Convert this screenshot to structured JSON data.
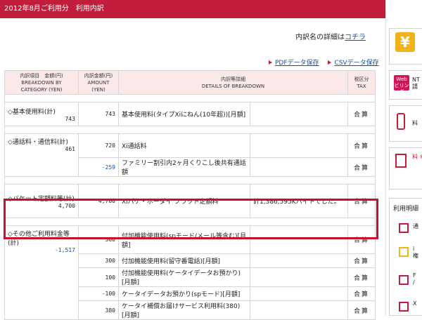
{
  "header": {
    "title": "2012年8月ご利用分　利用内訳"
  },
  "detail_note": {
    "text": "内訳名の詳細は",
    "link": "コチラ"
  },
  "downloads": {
    "pdf": "PDFデータ保存",
    "csv": "CSVデータ保存"
  },
  "table": {
    "headers": {
      "category": "内訳項目　金額(円)\nBREAKDOWN BY\nCATEGORY (YEN)",
      "amount": "内訳金額(円)\nAMOUNT\n(YEN)",
      "details": "内訳等詳細\nDETAILS OF BREAKDOWN",
      "tax": "税区分\nTAX"
    },
    "groups": [
      {
        "category": "◇基本使用料(計)",
        "total": "743",
        "rows": [
          {
            "amount": "743",
            "detail": "基本使用料(タイプXiにねん(10年超))[月額]",
            "note": "",
            "tax": "合算"
          }
        ]
      },
      {
        "category": "◇通話料・通信料(計)",
        "total": "461",
        "rows": [
          {
            "amount": "720",
            "detail": "Xi通話料",
            "note": "",
            "tax": "合算"
          },
          {
            "amount": "-259",
            "detail": "ファミリー割引内2ヶ月くりこし後共有通話額",
            "note": "",
            "tax": "合算"
          }
        ]
      },
      {
        "category": "◇パケット定額料等(計)",
        "total": "4,700",
        "rows": [
          {
            "amount": "4,700",
            "detail": "Xiパケ・ホーダイ フラット定額料",
            "note": "計1,386,595Kバイトでした。",
            "tax": "合算"
          }
        ]
      },
      {
        "category": "◇その他ご利用料金等(計)",
        "total": "-1,517",
        "rows": [
          {
            "amount": "300",
            "detail": "付加機能使用料(spモード/メール等含む)[月額]",
            "note": "",
            "tax": "合算"
          },
          {
            "amount": "300",
            "detail": "付加機能使用料(留守番電話)[月額]",
            "note": "",
            "tax": "合算"
          },
          {
            "amount": "100",
            "detail": "付加機能使用料(ケータイデータお預かり)[月額]",
            "note": "",
            "tax": "合算"
          },
          {
            "amount": "-100",
            "detail": "ケータイデータお預かり(spモード)[月額]",
            "note": "",
            "tax": "合算"
          },
          {
            "amount": "380",
            "detail": "ケータイ補償お届けサービス利用料(380)[月額]",
            "note": "",
            "tax": "合算"
          }
        ]
      }
    ]
  },
  "sidebar": {
    "yen_symbol": "¥",
    "web_badge": "Web\nビリング",
    "web_text": "NT\n請",
    "charge_text": "料",
    "doc_text": "料\n※\nロ\nお",
    "meisai_title": "利用明細",
    "item_texts": [
      "通",
      "i\n権",
      "F\n/",
      "X"
    ]
  },
  "colors": {
    "brand": "#c21d3b",
    "highlight": "#c8102e",
    "link": "#1a4fa6"
  }
}
